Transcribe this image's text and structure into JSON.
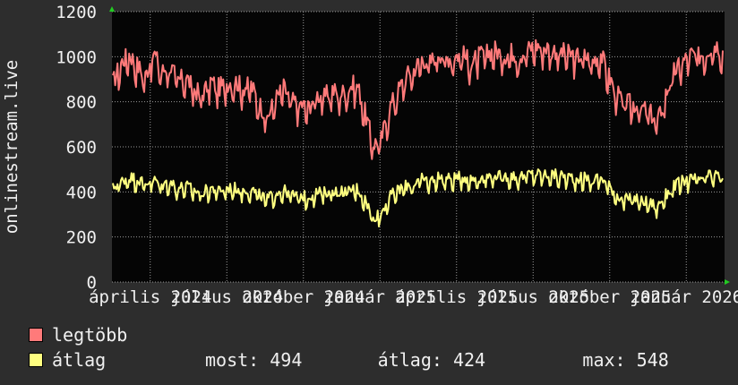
{
  "chart_data": {
    "type": "line",
    "ylabel": "onlinestream.live",
    "ylim": [
      0,
      1200
    ],
    "yticks": [
      "0",
      "200",
      "400",
      "600",
      "800",
      "1000",
      "1200"
    ],
    "xlabels": [
      "április 2024",
      "július 2024",
      "október 2024",
      "január 2025",
      "április 2025",
      "július 2025",
      "október 2025",
      "január 2026"
    ],
    "grid": true,
    "series": [
      {
        "name": "legtöbb",
        "color": "#ff7a7a",
        "weekly_values": [
          870,
          960,
          1000,
          950,
          900,
          1010,
          920,
          950,
          880,
          900,
          840,
          820,
          880,
          850,
          870,
          880,
          850,
          860,
          780,
          720,
          800,
          850,
          790,
          780,
          760,
          820,
          810,
          840,
          820,
          850,
          870,
          740,
          600,
          620,
          760,
          830,
          900,
          930,
          980,
          960,
          1010,
          980,
          990,
          1000,
          960,
          990,
          1000,
          1020,
          990,
          1010,
          990,
          1020,
          1040,
          1030,
          1020,
          1010,
          1000,
          990,
          990,
          970,
          1000,
          900,
          820,
          780,
          780,
          760,
          740,
          700,
          820,
          920,
          960,
          1000,
          990,
          1010,
          1050,
          1010
        ]
      },
      {
        "name": "átlag",
        "color": "#ffff80",
        "weekly_values": [
          410,
          440,
          460,
          450,
          430,
          450,
          420,
          440,
          410,
          420,
          400,
          390,
          410,
          400,
          410,
          410,
          400,
          405,
          380,
          360,
          390,
          400,
          380,
          375,
          370,
          390,
          390,
          400,
          395,
          400,
          410,
          360,
          280,
          300,
          370,
          400,
          420,
          430,
          450,
          440,
          460,
          450,
          455,
          460,
          450,
          455,
          460,
          470,
          460,
          465,
          460,
          470,
          475,
          470,
          470,
          465,
          460,
          455,
          455,
          445,
          460,
          420,
          380,
          360,
          365,
          355,
          345,
          330,
          380,
          420,
          440,
          450,
          450,
          460,
          470,
          460
        ]
      }
    ]
  },
  "legend": {
    "max_label": "legtöbb",
    "avg_label": "átlag",
    "stats": "most: 494       átlag: 424         max: 548"
  },
  "colors": {
    "background": "#2d2d2d",
    "plot": "#050505",
    "grid": "#9b9b9b",
    "axis_arrow": "#22cc22"
  }
}
